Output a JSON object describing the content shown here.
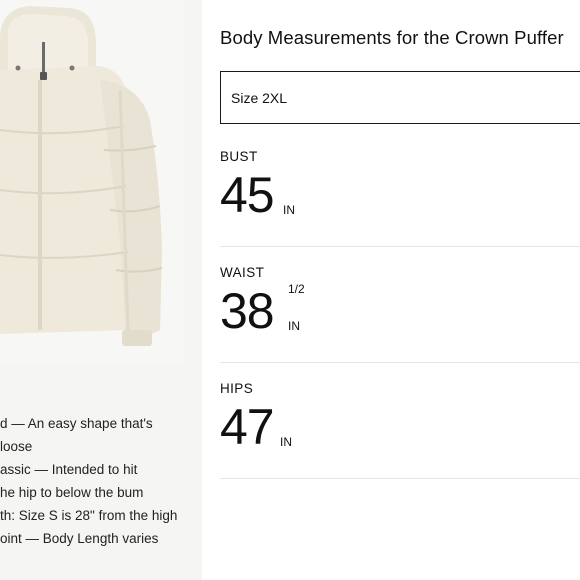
{
  "product": {
    "image_alt": "Crown Puffer jacket",
    "jacket_color": "#efe9dc"
  },
  "features": [
    "d — An easy shape that's",
    "loose",
    "assic — Intended to hit",
    "he hip to below the bum",
    "th: Size S is 28\" from the high",
    "oint — Body Length varies"
  ],
  "panel": {
    "title": "Body Measurements for the Crown Puffer",
    "size_value": "Size 2XL"
  },
  "measurements": [
    {
      "label": "BUST",
      "whole": "45",
      "fraction": "",
      "unit": "IN"
    },
    {
      "label": "WAIST",
      "whole": "38",
      "fraction": "1/2",
      "unit": "IN"
    },
    {
      "label": "HIPS",
      "whole": "47",
      "fraction": "",
      "unit": "IN"
    }
  ]
}
